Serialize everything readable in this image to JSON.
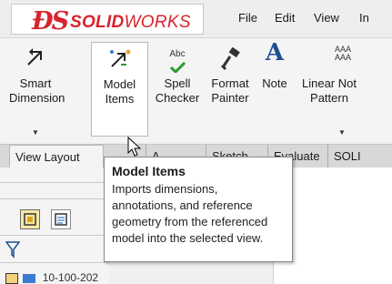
{
  "app": {
    "logo_ds": "ĐS",
    "logo_text_bold": "SOLID",
    "logo_text_light": "WORKS",
    "brand_color": "#d9232e"
  },
  "menu": [
    "File",
    "Edit",
    "View",
    "In"
  ],
  "ribbon": {
    "buttons": [
      {
        "label": "Smart\nDimension",
        "icon": "smart-dimension-icon",
        "has_dropdown": true
      },
      {
        "label": "Model\nItems",
        "icon": "model-items-icon",
        "active": true
      },
      {
        "label": "Spell\nChecker",
        "icon": "spell-checker-icon",
        "icon_text": "Abc"
      },
      {
        "label": "Format\nPainter",
        "icon": "format-painter-icon"
      },
      {
        "label": "Note",
        "icon": "note-icon",
        "icon_text": "A"
      },
      {
        "label": "Linear Not\nPattern",
        "icon": "linear-note-pattern-icon",
        "icon_text": "AAA\nAAA",
        "has_dropdown": true
      }
    ]
  },
  "tabs": {
    "selected": "View Layout",
    "others": [
      "A",
      "Sketch",
      "Evaluate",
      "SOLI"
    ]
  },
  "tooltip": {
    "title": "Model Items",
    "body": "Imports dimensions, annotations, and reference geometry from the referenced model into the selected view."
  },
  "tree": {
    "partial_item": "10-100-202"
  }
}
